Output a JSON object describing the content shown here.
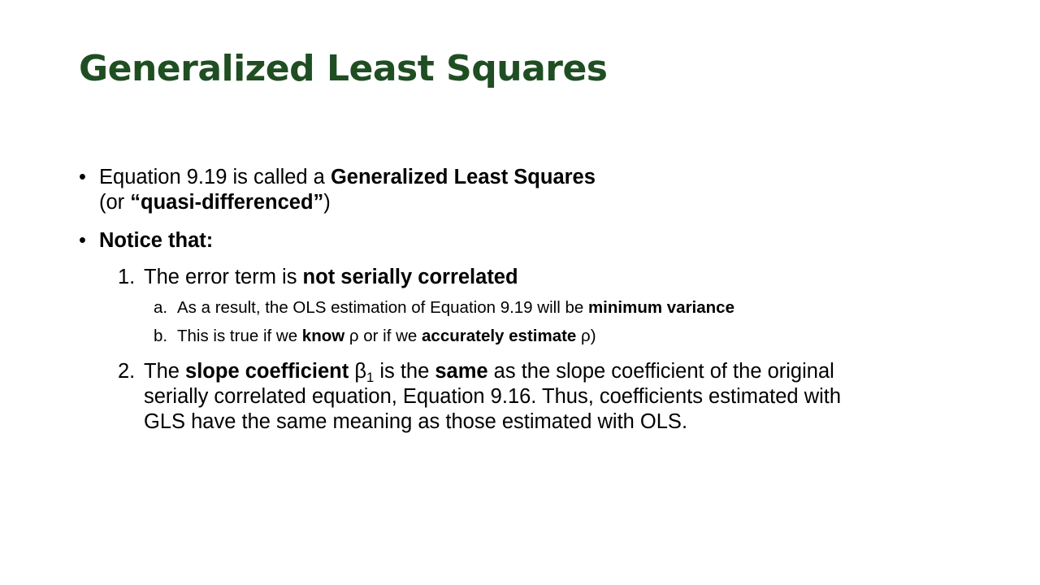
{
  "title": "Generalized Least Squares",
  "bullets": [
    {
      "marker": "•",
      "line1_pre": "Equation 9.19 is called a ",
      "line1_bold": "Generalized Least Squares",
      "line2_pre": "(or ",
      "line2_bold": "“quasi-differenced”",
      "line2_post": ")"
    },
    {
      "marker": "•",
      "bold": "Notice that:"
    }
  ],
  "numbered": [
    {
      "marker": "1.",
      "pre": "The error term is ",
      "bold": "not serially correlated",
      "subitems": [
        {
          "marker": "a.",
          "pre": "As a result, the OLS estimation of Equation 9.19 will be ",
          "bold": "minimum variance"
        },
        {
          "marker": "b.",
          "pre": "This is true if we ",
          "bold1": "know",
          "mid": " ρ or if we ",
          "bold2": "accurately estimate",
          "post": " ρ)"
        }
      ]
    },
    {
      "marker": "2.",
      "pre": "The ",
      "bold1": "slope coefficient",
      "mid1": " β",
      "subscript": "1",
      "mid2": " is the ",
      "bold2": "same",
      "post": " as the slope coefficient of the original",
      "line2": "serially correlated equation, Equation 9.16. Thus, coefficients estimated with",
      "line3": "GLS have the same meaning as those estimated with OLS."
    }
  ],
  "colors": {
    "title": "#1f4e22",
    "text": "#000000",
    "background": "#ffffff"
  }
}
